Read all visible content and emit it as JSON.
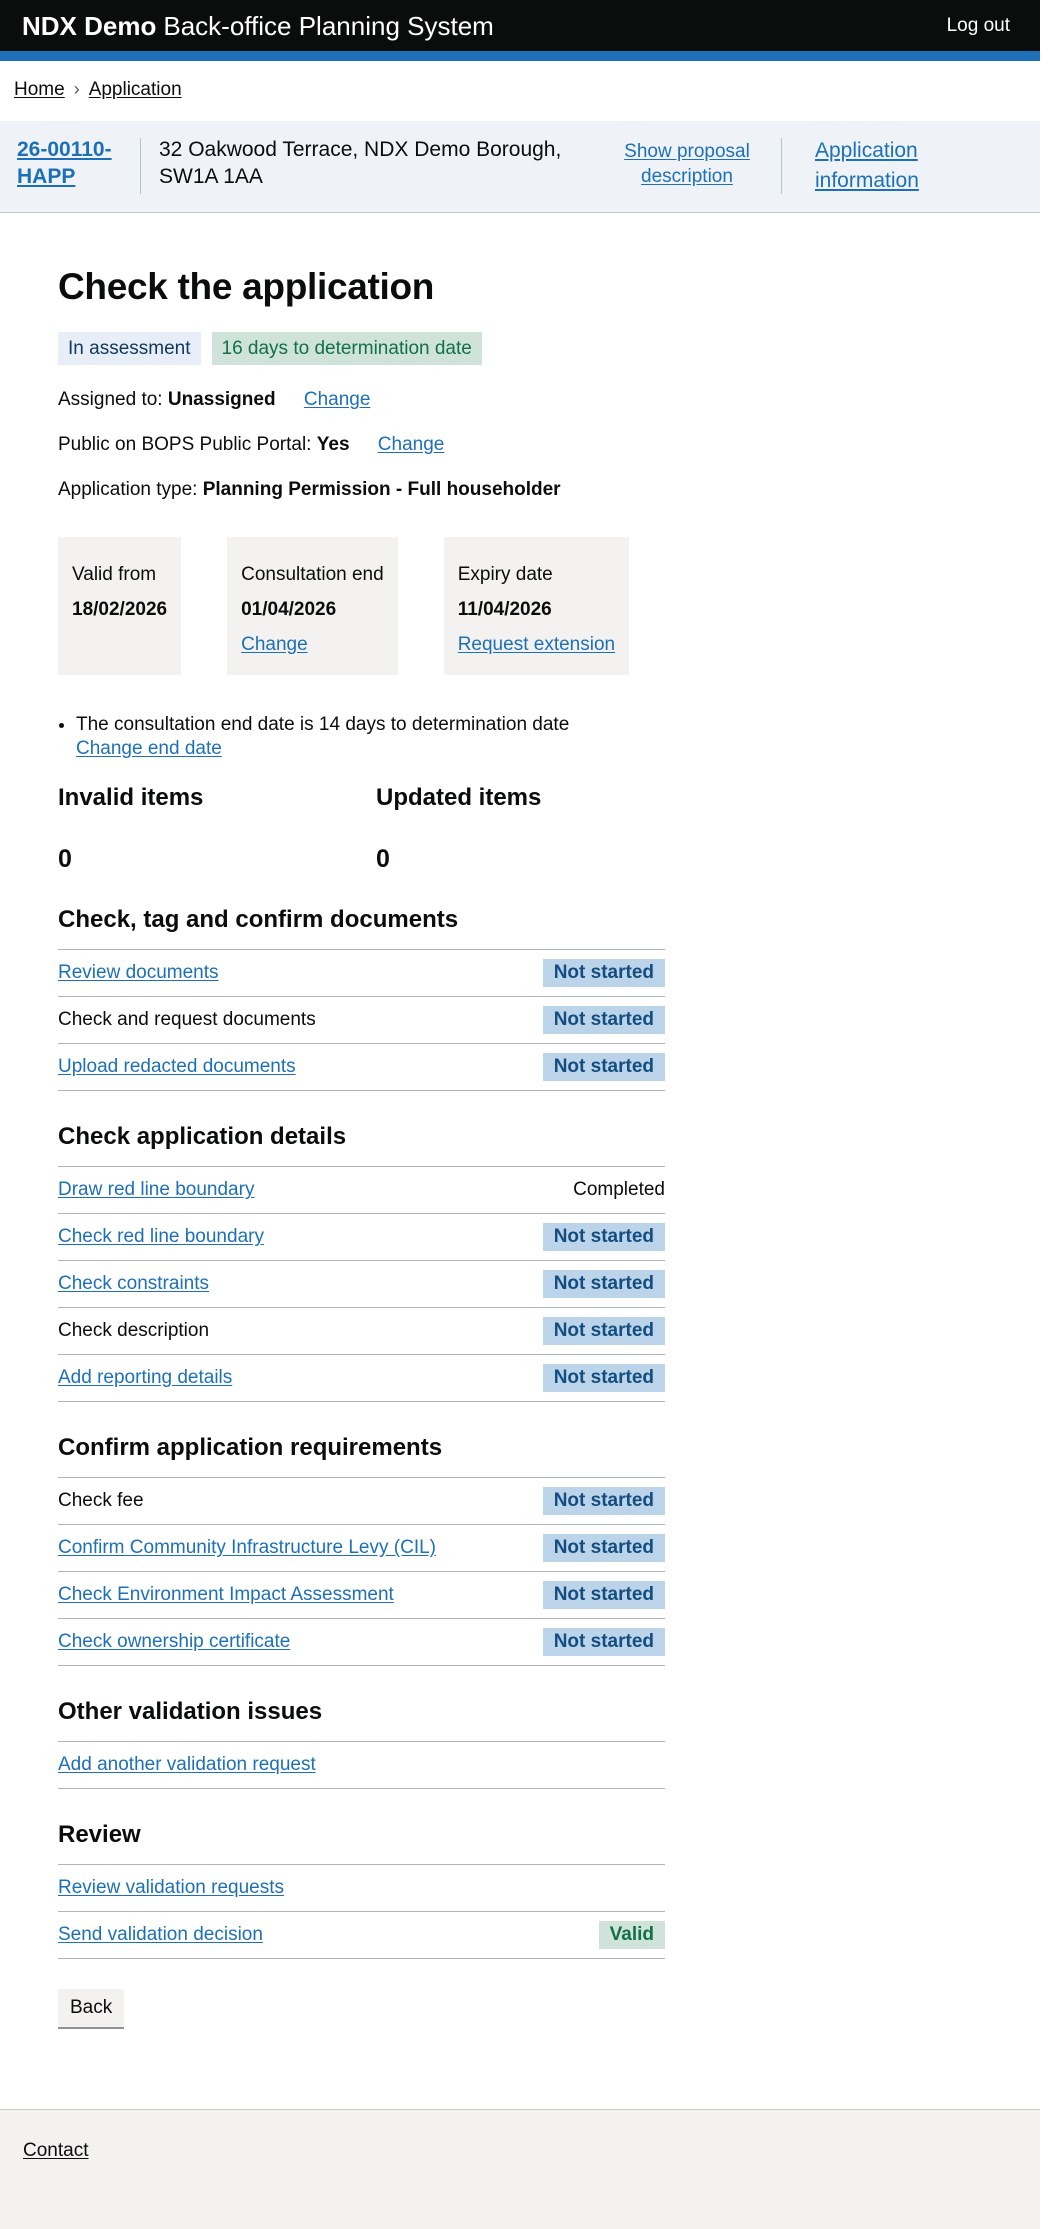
{
  "header": {
    "product": "NDX Demo",
    "title": "Back-office Planning System",
    "logout": "Log out"
  },
  "breadcrumb": {
    "items": [
      "Home",
      "Application"
    ],
    "separator": "›"
  },
  "banner": {
    "reference": "26-00110-HAPP",
    "address": "32 Oakwood Terrace, NDX Demo Borough, SW1A 1AA",
    "show_proposal": "Show proposal description",
    "application_info": "Application information"
  },
  "page": {
    "title": "Check the application",
    "status_tag": "In assessment",
    "days_tag": "16 days to determination date",
    "assigned_label": "Assigned to:",
    "assigned_value": "Unassigned",
    "assigned_change": "Change",
    "portal_label": "Public on BOPS Public Portal:",
    "portal_value": "Yes",
    "portal_change": "Change",
    "apptype_label": "Application type:",
    "apptype_value": "Planning Permission - Full householder"
  },
  "date_cards": [
    {
      "label": "Valid from",
      "value": "18/02/2026",
      "action": ""
    },
    {
      "label": "Consultation end",
      "value": "01/04/2026",
      "action": "Change"
    },
    {
      "label": "Expiry date",
      "value": "11/04/2026",
      "action": "Request extension"
    }
  ],
  "notice": {
    "text": "The consultation end date is 14 days to determination date",
    "link": "Change end date"
  },
  "counters": [
    {
      "label": "Invalid items",
      "value": "0"
    },
    {
      "label": "Updated items",
      "value": "0"
    }
  ],
  "sections": [
    {
      "title": "Check, tag and confirm documents",
      "tasks": [
        {
          "label": "Review documents",
          "link": true,
          "status": "Not started",
          "status_type": "tag-blue"
        },
        {
          "label": "Check and request documents",
          "link": false,
          "status": "Not started",
          "status_type": "tag-blue"
        },
        {
          "label": "Upload redacted documents",
          "link": true,
          "status": "Not started",
          "status_type": "tag-blue"
        }
      ]
    },
    {
      "title": "Check application details",
      "tasks": [
        {
          "label": "Draw red line boundary",
          "link": true,
          "status": "Completed",
          "status_type": "text"
        },
        {
          "label": "Check red line boundary",
          "link": true,
          "status": "Not started",
          "status_type": "tag-blue"
        },
        {
          "label": "Check constraints",
          "link": true,
          "status": "Not started",
          "status_type": "tag-blue"
        },
        {
          "label": "Check description",
          "link": false,
          "status": "Not started",
          "status_type": "tag-blue"
        },
        {
          "label": "Add reporting details",
          "link": true,
          "status": "Not started",
          "status_type": "tag-blue"
        }
      ]
    },
    {
      "title": "Confirm application requirements",
      "tasks": [
        {
          "label": "Check fee",
          "link": false,
          "status": "Not started",
          "status_type": "tag-blue"
        },
        {
          "label": "Confirm Community Infrastructure Levy (CIL)",
          "link": true,
          "status": "Not started",
          "status_type": "tag-blue"
        },
        {
          "label": "Check Environment Impact Assessment",
          "link": true,
          "status": "Not started",
          "status_type": "tag-blue"
        },
        {
          "label": "Check ownership certificate",
          "link": true,
          "status": "Not started",
          "status_type": "tag-blue"
        }
      ]
    },
    {
      "title": "Other validation issues",
      "tasks": [
        {
          "label": "Add another validation request",
          "link": true,
          "status": "",
          "status_type": "none"
        }
      ]
    },
    {
      "title": "Review",
      "tasks": [
        {
          "label": "Review validation requests",
          "link": true,
          "status": "",
          "status_type": "none"
        },
        {
          "label": "Send validation decision",
          "link": true,
          "status": "Valid",
          "status_type": "tag-green"
        }
      ]
    }
  ],
  "back_button": "Back",
  "footer": {
    "contact": "Contact"
  },
  "colors": {
    "header_bg": "#0b0c0c",
    "accent_blue": "#1d70b8",
    "banner_bg": "#eff3f8",
    "tag_blue_bg": "#bbd4ea",
    "tag_blue_text": "#144e81",
    "tag_lightblue_bg": "#e7eef8",
    "tag_green_bg": "#cfe3da",
    "tag_green_text": "#127049",
    "grey_bg": "#f3f2f1",
    "divider": "#b1b4b6"
  }
}
